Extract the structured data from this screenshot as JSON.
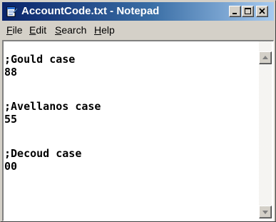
{
  "window": {
    "title": "AccountCode.txt - Notepad"
  },
  "title_buttons": [
    "minimize-icon",
    "maximize-icon",
    "close-icon"
  ],
  "menu": {
    "items": [
      {
        "underline": "F",
        "rest": "ile"
      },
      {
        "underline": "E",
        "rest": "dit"
      },
      {
        "underline": "S",
        "rest": "earch"
      },
      {
        "underline": "H",
        "rest": "elp"
      }
    ]
  },
  "document": {
    "lines": [
      ";Gould case",
      "88",
      "",
      ";Avellanos case",
      "55",
      "",
      ";Decoud case",
      "00"
    ]
  },
  "scrollbar": {
    "icons": [
      "scroll-up-arrow-icon",
      "scroll-down-arrow-icon"
    ]
  },
  "colors": {
    "titlebar_start": "#0a246a",
    "titlebar_end": "#a6caf0",
    "face": "#d4d0c8"
  }
}
